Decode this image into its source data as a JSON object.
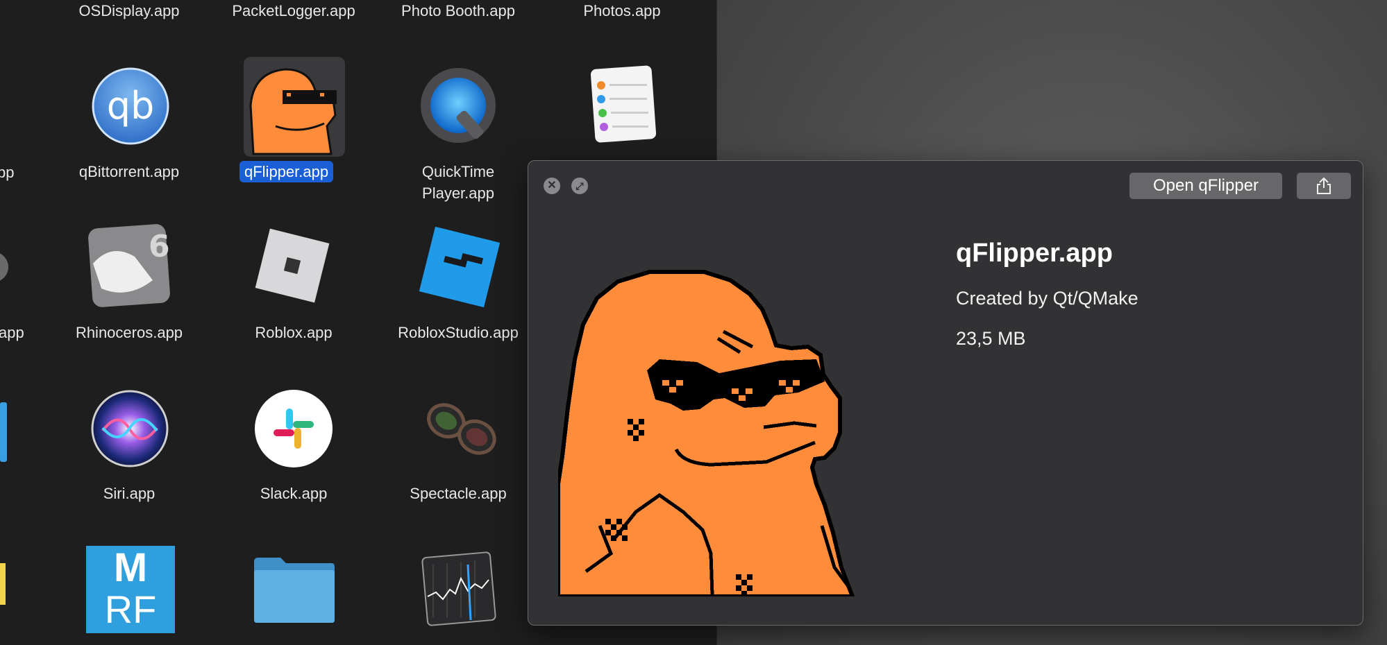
{
  "finder": {
    "top_row": [
      "OSDisplay.app",
      "PacketLogger.app",
      "Photo Booth.app",
      "Photos.app"
    ],
    "apps": [
      {
        "label": "qBittorrent.app",
        "icon": "qbittorrent-icon"
      },
      {
        "label": "qFlipper.app",
        "icon": "qflipper-icon",
        "selected": true
      },
      {
        "label1": "QuickTime",
        "label2": "Player.app",
        "icon": "quicktime-icon"
      },
      {
        "label": "",
        "icon": "reminders-icon"
      },
      {
        "label": "Rhinoceros.app",
        "icon": "rhinoceros-icon"
      },
      {
        "label": "Roblox.app",
        "icon": "roblox-icon"
      },
      {
        "label": "RobloxStudio.app",
        "icon": "roblox-studio-icon"
      },
      {
        "label": "Siri.app",
        "icon": "siri-icon"
      },
      {
        "label": "Slack.app",
        "icon": "slack-icon"
      },
      {
        "label": "Spectacle.app",
        "icon": "spectacle-icon"
      }
    ],
    "partial_left": [
      "pp",
      "app"
    ],
    "mrf_text_top": "M",
    "mrf_text_bottom": "RF",
    "rhino_badge": "6"
  },
  "quicklook": {
    "close_glyph": "✕",
    "fullscreen_glyph": "⤢",
    "open_button_label": "Open qFlipper",
    "share_icon": "share-icon",
    "title": "qFlipper.app",
    "creator": "Created by Qt/QMake",
    "size": "23,5 MB"
  },
  "colors": {
    "selection": "#1a5fd6",
    "qflipper_orange": "#ff8c3a",
    "panel_bg": "#323234"
  }
}
